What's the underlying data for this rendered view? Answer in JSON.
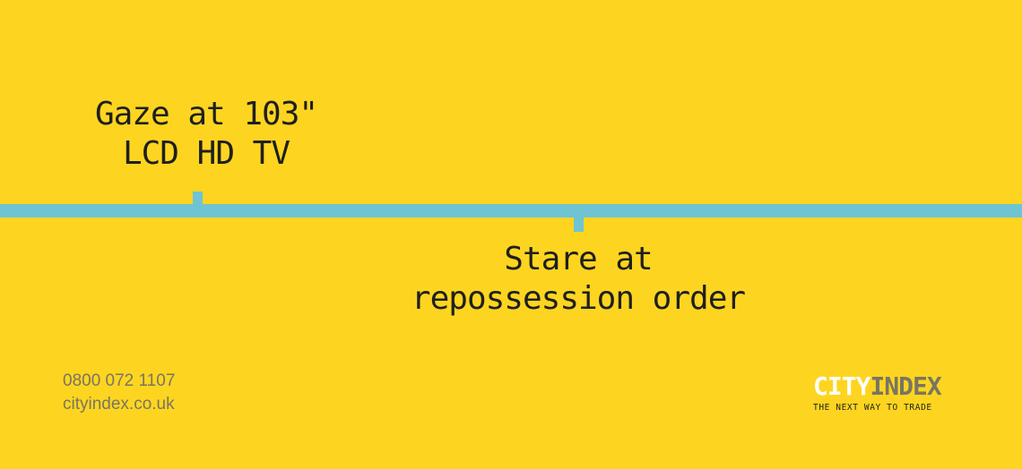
{
  "ad": {
    "background_color": "#FDD520",
    "timeline_color": "#6FC4D3",
    "caption_top": {
      "line1": "Gaze at 103\"",
      "line2": "LCD HD TV"
    },
    "caption_bottom": {
      "line1": "Stare at",
      "line2": "repossession order"
    },
    "contact": {
      "phone": "0800 072 1107",
      "website": "cityindex.co.uk"
    },
    "logo": {
      "word_city": "CITY",
      "word_index": "INDEX",
      "tagline": "THE NEXT WAY TO TRADE"
    }
  }
}
